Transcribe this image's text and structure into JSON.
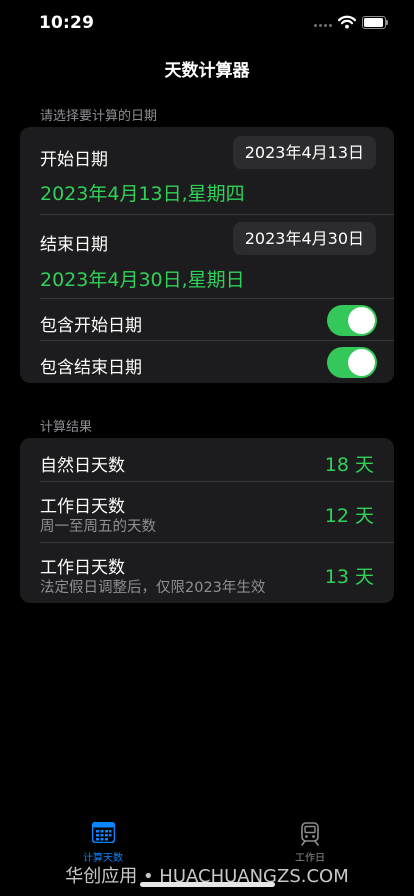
{
  "colors": {
    "background": "#000000",
    "card": "#1c1c1e",
    "pill": "#2c2c2e",
    "accent_green": "#30d158",
    "toggle_green": "#34c759",
    "secondary_text": "#8e8e93",
    "tab_active": "#0a84ff",
    "tab_inactive": "#8e8e93"
  },
  "status_bar": {
    "time": "10:29",
    "icons": [
      "cellular-dots-icon",
      "wifi-icon",
      "battery-icon"
    ]
  },
  "nav": {
    "title": "天数计算器"
  },
  "date_section": {
    "header": "请选择要计算的日期",
    "start": {
      "label": "开始日期",
      "picker_value": "2023年4月13日",
      "detail": "2023年4月13日,星期四"
    },
    "end": {
      "label": "结束日期",
      "picker_value": "2023年4月30日",
      "detail": "2023年4月30日,星期日"
    },
    "include_start": {
      "label": "包含开始日期",
      "on": true
    },
    "include_end": {
      "label": "包含结束日期",
      "on": true
    }
  },
  "result_section": {
    "header": "计算结果",
    "rows": [
      {
        "title": "自然日天数",
        "subtitle": "",
        "value": "18 天"
      },
      {
        "title": "工作日天数",
        "subtitle": "周一至周五的天数",
        "value": "12 天"
      },
      {
        "title": "工作日天数",
        "subtitle": "法定假日调整后，仅限2023年生效",
        "value": "13 天"
      }
    ]
  },
  "tab_bar": {
    "tabs": [
      {
        "label": "计算天数",
        "icon": "calendar-icon",
        "active": true
      },
      {
        "label": "工作日",
        "icon": "train-icon",
        "active": false
      }
    ]
  },
  "watermark": "华创应用 • HUACHUANGZS.COM"
}
